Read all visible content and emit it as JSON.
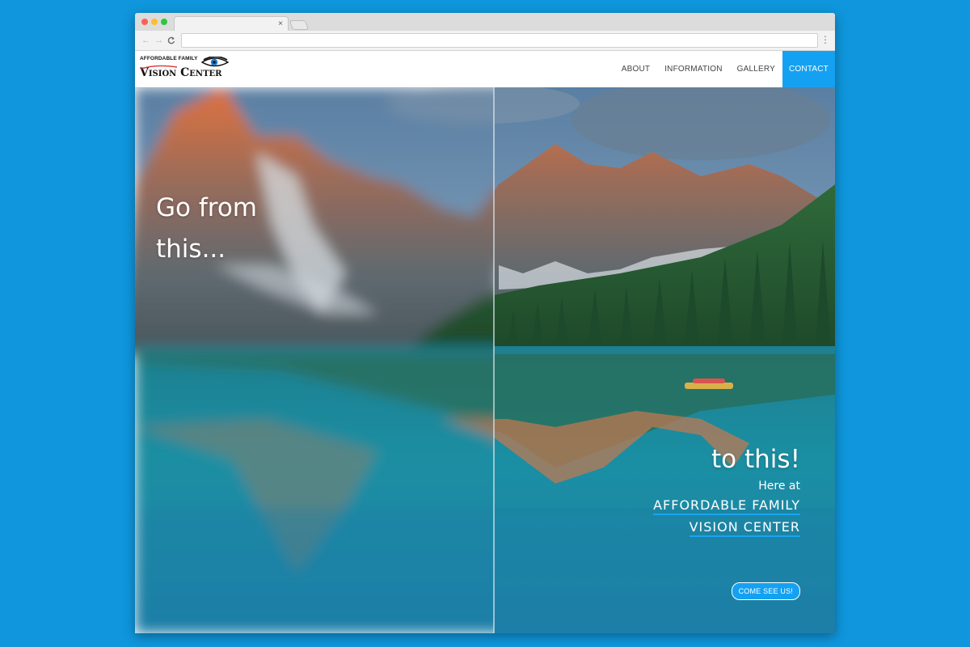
{
  "browser": {
    "tab_close": "×",
    "nav_back": "←",
    "nav_forward": "→",
    "nav_reload": "C",
    "menu": "⋮"
  },
  "site": {
    "logo_top": "AFFORDABLE FAMILY",
    "logo_bottom": "Vision Center",
    "nav": {
      "about": "ABOUT",
      "information": "INFORMATION",
      "gallery": "GALLERY",
      "contact": "CONTACT"
    }
  },
  "hero": {
    "left_line1": "Go from",
    "left_line2": "this...",
    "right_headline": "to this!",
    "here_at": "Here at",
    "brand_line1": "AFFORDABLE FAMILY",
    "brand_line2": "VISION CENTER",
    "cta_label": "COME SEE US!"
  },
  "colors": {
    "page_background": "#0f96dc",
    "accent": "#14a1f2"
  }
}
